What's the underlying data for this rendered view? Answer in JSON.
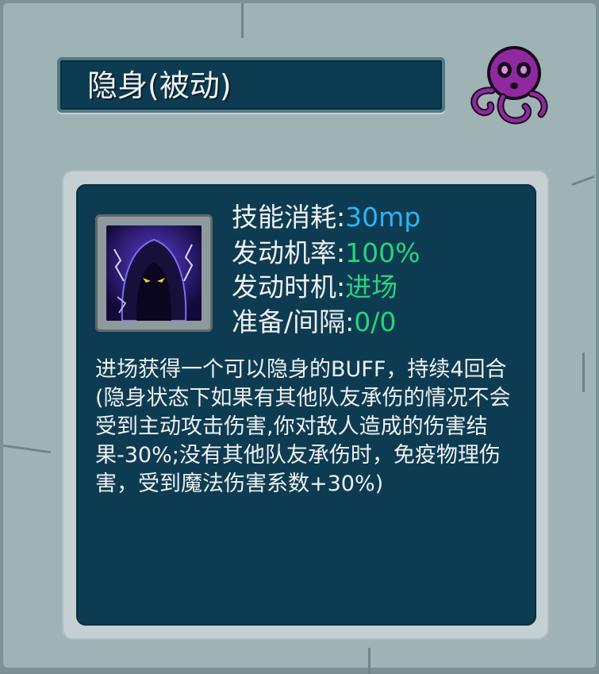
{
  "title": "隐身(被动)",
  "emblem_icon": "purple-octopus-icon",
  "skill_icon": "hooded-shadow-figure-icon",
  "stats": [
    {
      "label": "技能消耗:",
      "value": "30mp",
      "color": "#2fb2f4"
    },
    {
      "label": "发动机率:",
      "value": "100%",
      "color": "#2ad37a"
    },
    {
      "label": "发动时机:",
      "value": "进场",
      "color": "#2ad37a"
    },
    {
      "label": "准备/间隔:",
      "value": "0/0",
      "color": "#2ad37a"
    }
  ],
  "description": "进场获得一个可以隐身的BUFF，持续4回合(隐身状态下如果有其他队友承伤的情况不会受到主动攻击伤害,你对敌人造成的伤害结果-30%;没有其他队友承伤时，免疫物理伤害，受到魔法伤害系数+30%)",
  "colors": {
    "frame": "#9fb3b5",
    "panel": "#0d3c52",
    "accent_blue": "#2fb2f4",
    "accent_green": "#2ad37a",
    "emblem": "#8e2a9e"
  }
}
